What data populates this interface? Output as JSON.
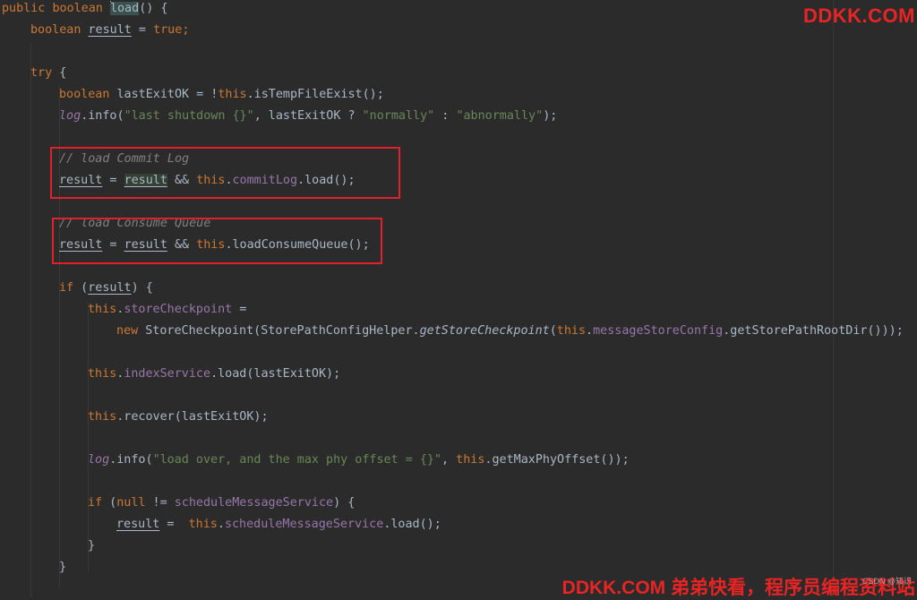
{
  "code": {
    "l1": {
      "kw1": "public",
      "kw2": "boolean",
      "method": "load",
      "tail": "() {"
    },
    "l2": {
      "kw": "boolean",
      "var": "result",
      "eq": " = ",
      "val": "true",
      "semi": ";"
    },
    "l4": {
      "kw": "try",
      "tail": " {"
    },
    "l5": {
      "kw": "boolean",
      "mid": " lastExitOK = !",
      "kwThis": "this",
      "tail": ".isTempFileExist();"
    },
    "l6": {
      "log": "log",
      "call": ".info(",
      "str1": "\"last shutdown {}\"",
      "mid": ", lastExitOK ? ",
      "str2": "\"normally\"",
      "colon": " : ",
      "str3": "\"abnormally\"",
      "tail": ");"
    },
    "l8": {
      "comment": "// load Commit Log"
    },
    "l9": {
      "var1": "result",
      "eq": " = ",
      "var2": "result",
      "and": " && ",
      "kwThis": "this",
      "dot": ".",
      "field": "commitLog",
      "tail": ".load();"
    },
    "l11": {
      "comment": "// load Consume Queue"
    },
    "l12": {
      "var1": "result",
      "eq": " = ",
      "var2": "result",
      "and": " && ",
      "kwThis": "this",
      "tail": ".loadConsumeQueue();"
    },
    "l14": {
      "kw": "if",
      "open": " (",
      "var": "result",
      "tail": ") {"
    },
    "l15": {
      "kwThis": "this",
      "dot": ".",
      "field": "storeCheckpoint",
      "tail": " ="
    },
    "l16": {
      "kwNew": "new",
      "mid": " StoreCheckpoint(StorePathConfigHelper.",
      "staticCall": "getStoreCheckpoint",
      "open": "(",
      "kwThis": "this",
      "dot": ".",
      "field": "messageStoreConfig",
      "tail": ".getStorePathRootDir()));"
    },
    "l18": {
      "kwThis": "this",
      "dot": ".",
      "field": "indexService",
      "tail": ".load(lastExitOK);"
    },
    "l20": {
      "kwThis": "this",
      "tail": ".recover(lastExitOK);"
    },
    "l22": {
      "log": "log",
      "call": ".info(",
      "str": "\"load over, and the max phy offset = {}\"",
      "comma": ", ",
      "kwThis": "this",
      "tail": ".getMaxPhyOffset());"
    },
    "l24": {
      "kw": "if",
      "open": " (",
      "kwNull": "null",
      "op": " != ",
      "field": "scheduleMessageService",
      "tail": ") {"
    },
    "l25": {
      "var": "result",
      "eq": " =  ",
      "kwThis": "this",
      "dot": ".",
      "field": "scheduleMessageService",
      "tail": ".load();"
    },
    "l26": {
      "brace": "}"
    },
    "l27": {
      "brace": "}"
    }
  },
  "watermarks": {
    "top": "DDKK.COM",
    "bottom": "DDKK.COM 弟弟快看，程序员编程资料站",
    "csdn": "CSDN @知识"
  },
  "colors": {
    "background": "#2b2b2b",
    "keyword": "#cc7832",
    "field": "#9876aa",
    "string": "#6a8759",
    "comment": "#808080",
    "text": "#a9b7c6",
    "highlight_box": "#e0202a",
    "watermark": "#e82424"
  }
}
